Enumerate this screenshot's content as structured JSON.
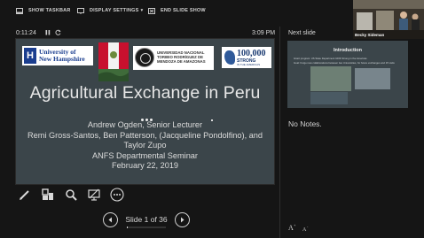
{
  "toolbar": {
    "show_taskbar": "SHOW TASKBAR",
    "display_settings": "DISPLAY SETTINGS",
    "display_settings_caret": "▾",
    "end_slide_show": "END SLIDE SHOW"
  },
  "timer": {
    "elapsed": "0:11:24",
    "clock": "3:09 PM"
  },
  "slide": {
    "title": "Agricultural Exchange in Peru",
    "presenter_line": "Andrew Ogden, Senior Lecturer",
    "coauthors_line1": "Remi Gross-Santos, Ben Patterson, (Jacqueline Pondolfino), and",
    "coauthors_line2": "Taylor Zupo",
    "seminar": "ANFS Departmental Seminar",
    "date": "February 22, 2019",
    "logos": {
      "unh_line1": "University of",
      "unh_line2": "New Hampshire",
      "unh_letter": "H",
      "unt_text": "UNIVERSIDAD NACIONAL TORIBIO RODRÍGUEZ DE MENDOZA DE AMAZONAS",
      "strong_num": "100,000",
      "strong_word": "STRONG",
      "strong_sub": "IN THE AMERICAS"
    }
  },
  "navigation": {
    "counter": "Slide 1 of 36",
    "current": 1,
    "total": 36
  },
  "next_slide": {
    "label": "Next slide",
    "title": "Introduction",
    "line1": "Grant program: US State Department 100K Strong in the Americas",
    "line2": "Goal: Forge new collaborations between two Universities, for future exchanges and 15 visits"
  },
  "notes": {
    "text": "No Notes."
  },
  "webcam": {
    "name": "Becky Sideman"
  },
  "colors": {
    "background": "#151515",
    "slide_bg": "#3b454a",
    "text": "#d8d8d8"
  }
}
